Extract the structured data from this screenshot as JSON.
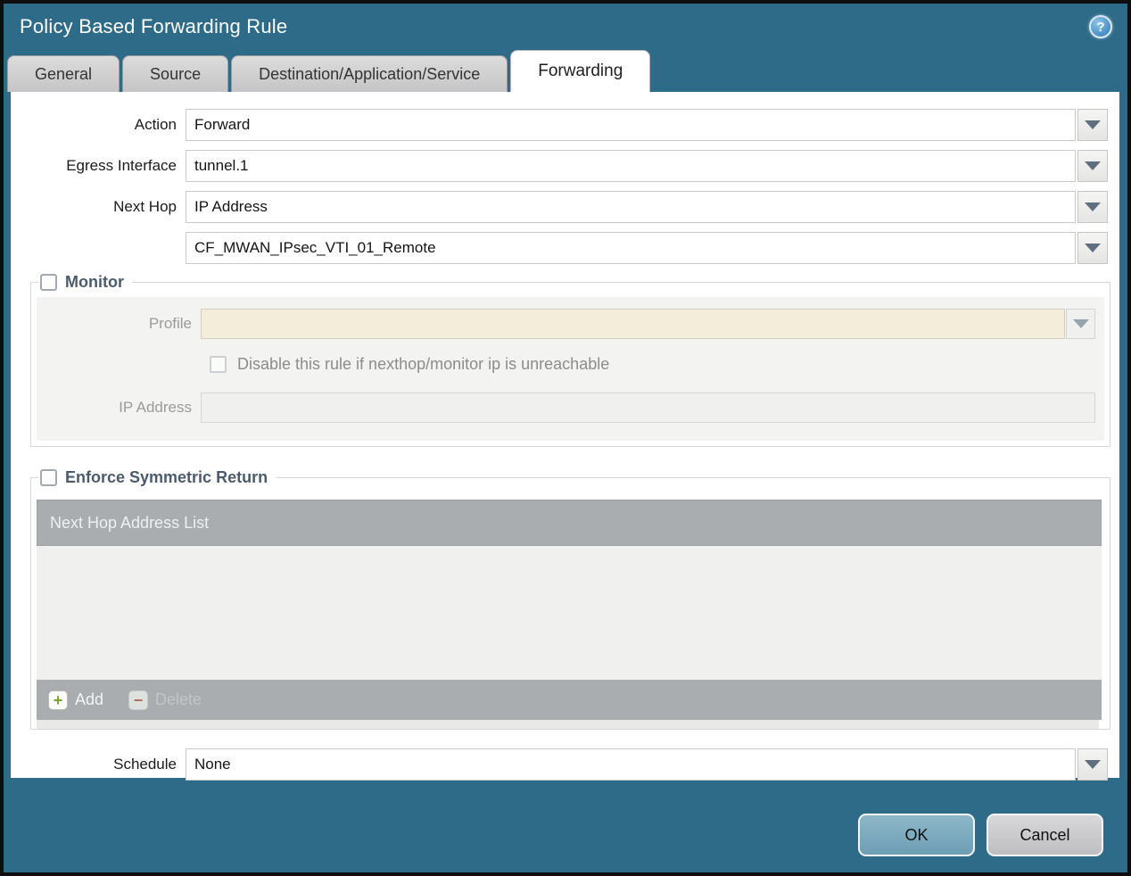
{
  "window": {
    "title": "Policy Based Forwarding Rule"
  },
  "icons": {
    "help": "?",
    "add_plus": "+",
    "delete_minus": "−"
  },
  "tabs": {
    "general": "General",
    "source": "Source",
    "destination": "Destination/Application/Service",
    "forwarding": "Forwarding",
    "active_tab": "Forwarding"
  },
  "form": {
    "action_label": "Action",
    "action_value": "Forward",
    "egress_label": "Egress Interface",
    "egress_value": "tunnel.1",
    "next_hop_label": "Next Hop",
    "next_hop_value": "IP Address",
    "next_hop_address_value": "CF_MWAN_IPsec_VTI_01_Remote",
    "schedule_label": "Schedule",
    "schedule_value": "None"
  },
  "monitor": {
    "legend": "Monitor",
    "checked": false,
    "profile_label": "Profile",
    "profile_value": "",
    "disable_label": "Disable this rule if nexthop/monitor ip is unreachable",
    "disable_checked": false,
    "ip_label": "IP Address",
    "ip_value": ""
  },
  "symmetric": {
    "legend": "Enforce Symmetric Return",
    "checked": false,
    "table_header": "Next Hop Address List",
    "rows": [],
    "add_label": "Add",
    "delete_label": "Delete",
    "delete_enabled": false
  },
  "footer": {
    "ok": "OK",
    "cancel": "Cancel"
  },
  "colors": {
    "titlebar": "#2e6b89",
    "legend_text": "#4b5b6b",
    "table_header_bg": "#a9adb0",
    "panel_bg": "#f3f3f1",
    "profile_field_bg": "#f4edd9",
    "ok_button_bg": "#7aa9be",
    "cancel_button_bg": "#c9c9cc",
    "add_icon_green": "#7ea332",
    "delete_icon_red": "#aa6e63"
  }
}
